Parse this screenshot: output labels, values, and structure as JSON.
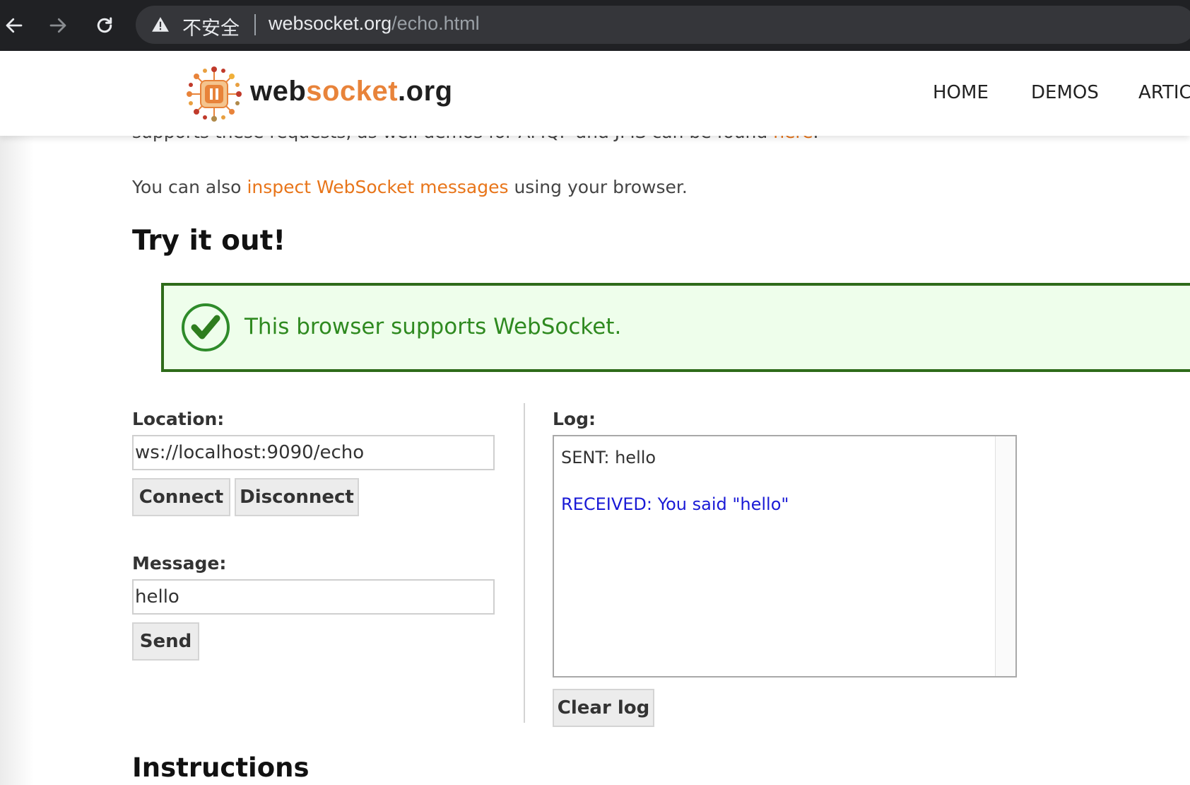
{
  "browser": {
    "security_label": "不安全",
    "url_host": "websocket.org",
    "url_path": "/echo.html"
  },
  "site": {
    "logo_text_a": "web",
    "logo_text_b": "socket",
    "logo_text_c": ".org",
    "nav": [
      "HOME",
      "DEMOS",
      "ARTIC"
    ]
  },
  "content": {
    "cut_line_before": "supports these requests, as well demos for AMQP and JMS can be found ",
    "cut_line_link": "here",
    "cut_line_after": ".",
    "para_before": "You can also ",
    "para_link": "inspect WebSocket messages",
    "para_after": " using your browser.",
    "heading": "Try it out!",
    "support_message": "This browser supports WebSocket.",
    "location_label": "Location:",
    "location_value": "ws://localhost:9090/echo",
    "connect_button": "Connect",
    "disconnect_button": "Disconnect",
    "message_label": "Message:",
    "message_value": "hello",
    "send_button": "Send",
    "log_label": "Log:",
    "log_sent": "SENT: hello",
    "log_received": "RECEIVED: You said \"hello\"",
    "clear_log_button": "Clear log",
    "instructions_heading": "Instructions"
  },
  "colors": {
    "accent_orange": "#e8751a",
    "success_green": "#2f8a20",
    "received_blue": "#1a1ad6"
  }
}
